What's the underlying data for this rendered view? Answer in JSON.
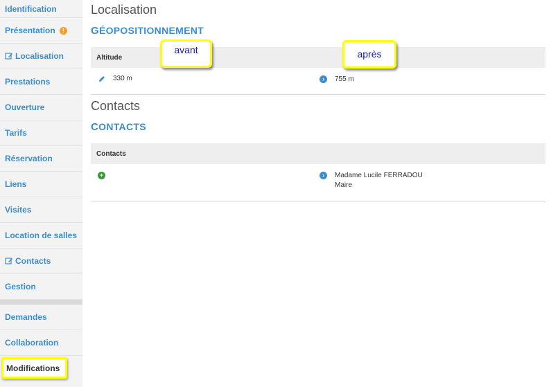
{
  "sidebar": {
    "items": [
      {
        "label": "Identification"
      },
      {
        "label": "Présentation"
      },
      {
        "label": "Localisation"
      },
      {
        "label": "Prestations"
      },
      {
        "label": "Ouverture"
      },
      {
        "label": "Tarifs"
      },
      {
        "label": "Réservation"
      },
      {
        "label": "Liens"
      },
      {
        "label": "Visites"
      },
      {
        "label": "Location de salles"
      },
      {
        "label": "Contacts"
      },
      {
        "label": "Gestion"
      }
    ],
    "secondary": [
      {
        "label": "Demandes"
      },
      {
        "label": "Collaboration"
      },
      {
        "label": "Modifications"
      }
    ],
    "warning_glyph": "!"
  },
  "localisation": {
    "title": "Localisation",
    "subtitle_first": "G",
    "subtitle_rest": "ÉOPOSITIONNEMENT",
    "table_header": "Altitude",
    "before_value": "330 m",
    "after_value": "755 m"
  },
  "contacts": {
    "title": "Contacts",
    "subtitle_first": "C",
    "subtitle_rest": "ONTACTS",
    "table_header": "Contacts",
    "after_name": "Madame Lucile FERRADOU",
    "after_role": "Maire"
  },
  "callouts": {
    "before": "avant",
    "after": "après"
  },
  "colors": {
    "accent": "#3c8dcd",
    "highlight": "#ffff00",
    "warning": "#f0a020",
    "add": "#3a9a3a"
  },
  "icons": {
    "edit": "pencil-square-icon",
    "warning": "exclamation-circle-icon",
    "pencil": "pencil-icon",
    "arrow": "chevron-right-circle-icon",
    "add": "plus-circle-icon"
  }
}
